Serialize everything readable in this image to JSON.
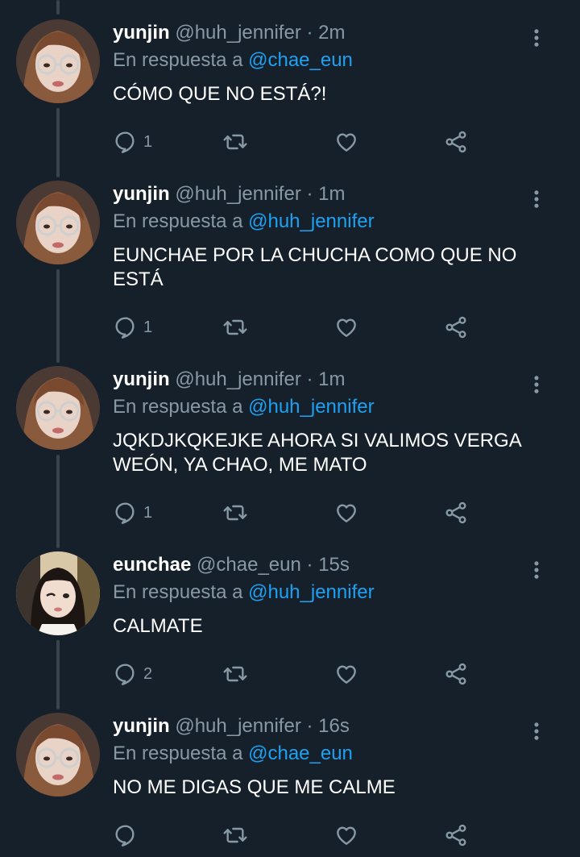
{
  "colors": {
    "background": "#15202b",
    "text_primary": "#ffffff",
    "text_secondary": "#8899a6",
    "link": "#1da1f2",
    "thread_line": "#38444d"
  },
  "icons": {
    "reply": "speech-bubble-icon",
    "retweet": "retweet-arrows-icon",
    "like": "heart-icon",
    "share": "share-nodes-icon",
    "more": "vertical-dots-icon"
  },
  "tweets": [
    {
      "avatar": "avatar-yunjin",
      "name": "yunjin",
      "handle": "@huh_jennifer",
      "separator": "·",
      "time": "2m",
      "reply_prefix": "En respuesta a",
      "reply_to": "@chae_eun",
      "text": "CÓMO QUE NO ESTÁ?!",
      "reply_count": "1"
    },
    {
      "avatar": "avatar-yunjin",
      "name": "yunjin",
      "handle": "@huh_jennifer",
      "separator": "·",
      "time": "1m",
      "reply_prefix": "En respuesta a",
      "reply_to": "@huh_jennifer",
      "text": "EUNCHAE POR LA CHUCHA COMO QUE NO ESTÁ",
      "reply_count": "1"
    },
    {
      "avatar": "avatar-yunjin",
      "name": "yunjin",
      "handle": "@huh_jennifer",
      "separator": "·",
      "time": "1m",
      "reply_prefix": "En respuesta a",
      "reply_to": "@huh_jennifer",
      "text": "JQKDJKQKEJKE AHORA SI VALIMOS VERGA WEÓN, YA CHAO, ME MATO",
      "reply_count": "1"
    },
    {
      "avatar": "avatar-eunchae",
      "name": "eunchae",
      "handle": "@chae_eun",
      "separator": "·",
      "time": "15s",
      "reply_prefix": "En respuesta a",
      "reply_to": "@huh_jennifer",
      "text": "CALMATE",
      "reply_count": "2"
    },
    {
      "avatar": "avatar-yunjin",
      "name": "yunjin",
      "handle": "@huh_jennifer",
      "separator": "·",
      "time": "16s",
      "reply_prefix": "En respuesta a",
      "reply_to": "@chae_eun",
      "text": "NO ME DIGAS QUE ME CALME",
      "reply_count": ""
    }
  ]
}
